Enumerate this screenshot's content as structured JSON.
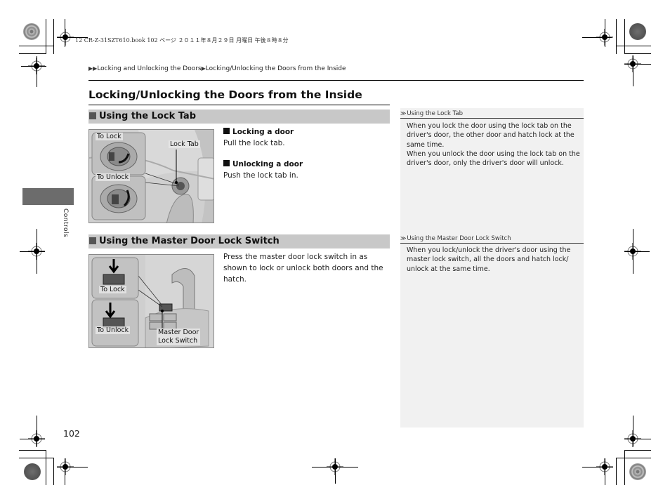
{
  "file_header": "12 CR-Z-31SZT610.book  102 ページ  ２０１１年８月２９日  月曜日  午後８時８分",
  "breadcrumb": {
    "marker": "▶▶",
    "parent": "Locking and Unlocking the Doors",
    "separator": "▶",
    "current": "Locking/Unlocking the Doors from the Inside"
  },
  "page_title": "Locking/Unlocking the Doors from the Inside",
  "side_tab": {
    "label": "Controls"
  },
  "page_number": "102",
  "sections": [
    {
      "heading": "Using the Lock Tab",
      "figure": {
        "labels": {
          "to_lock": "To Lock",
          "to_unlock": "To Unlock",
          "callout": "Lock Tab"
        }
      },
      "steps": [
        {
          "heading": "Locking a door",
          "text": "Pull the lock tab."
        },
        {
          "heading": "Unlocking a door",
          "text": "Push the lock tab in."
        }
      ],
      "note": {
        "icon": "≫",
        "heading": "Using the Lock Tab",
        "paragraphs": [
          "When you lock the door using the lock tab on the driver's door, the other door and hatch lock at the same time.",
          "When you unlock the door using the lock tab on the driver's door, only the driver's door will unlock."
        ]
      }
    },
    {
      "heading": "Using the Master Door Lock Switch",
      "figure": {
        "labels": {
          "to_lock": "To Lock",
          "to_unlock": "To Unlock",
          "callout_line1": "Master Door",
          "callout_line2": "Lock Switch"
        }
      },
      "text": "Press the master door lock switch in as shown to lock or unlock both doors and the hatch.",
      "note": {
        "icon": "≫",
        "heading": "Using the Master Door Lock Switch",
        "paragraphs": [
          "When you lock/unlock the driver's door using the master lock switch, all the doors and hatch lock/ unlock at the same time."
        ]
      }
    }
  ]
}
